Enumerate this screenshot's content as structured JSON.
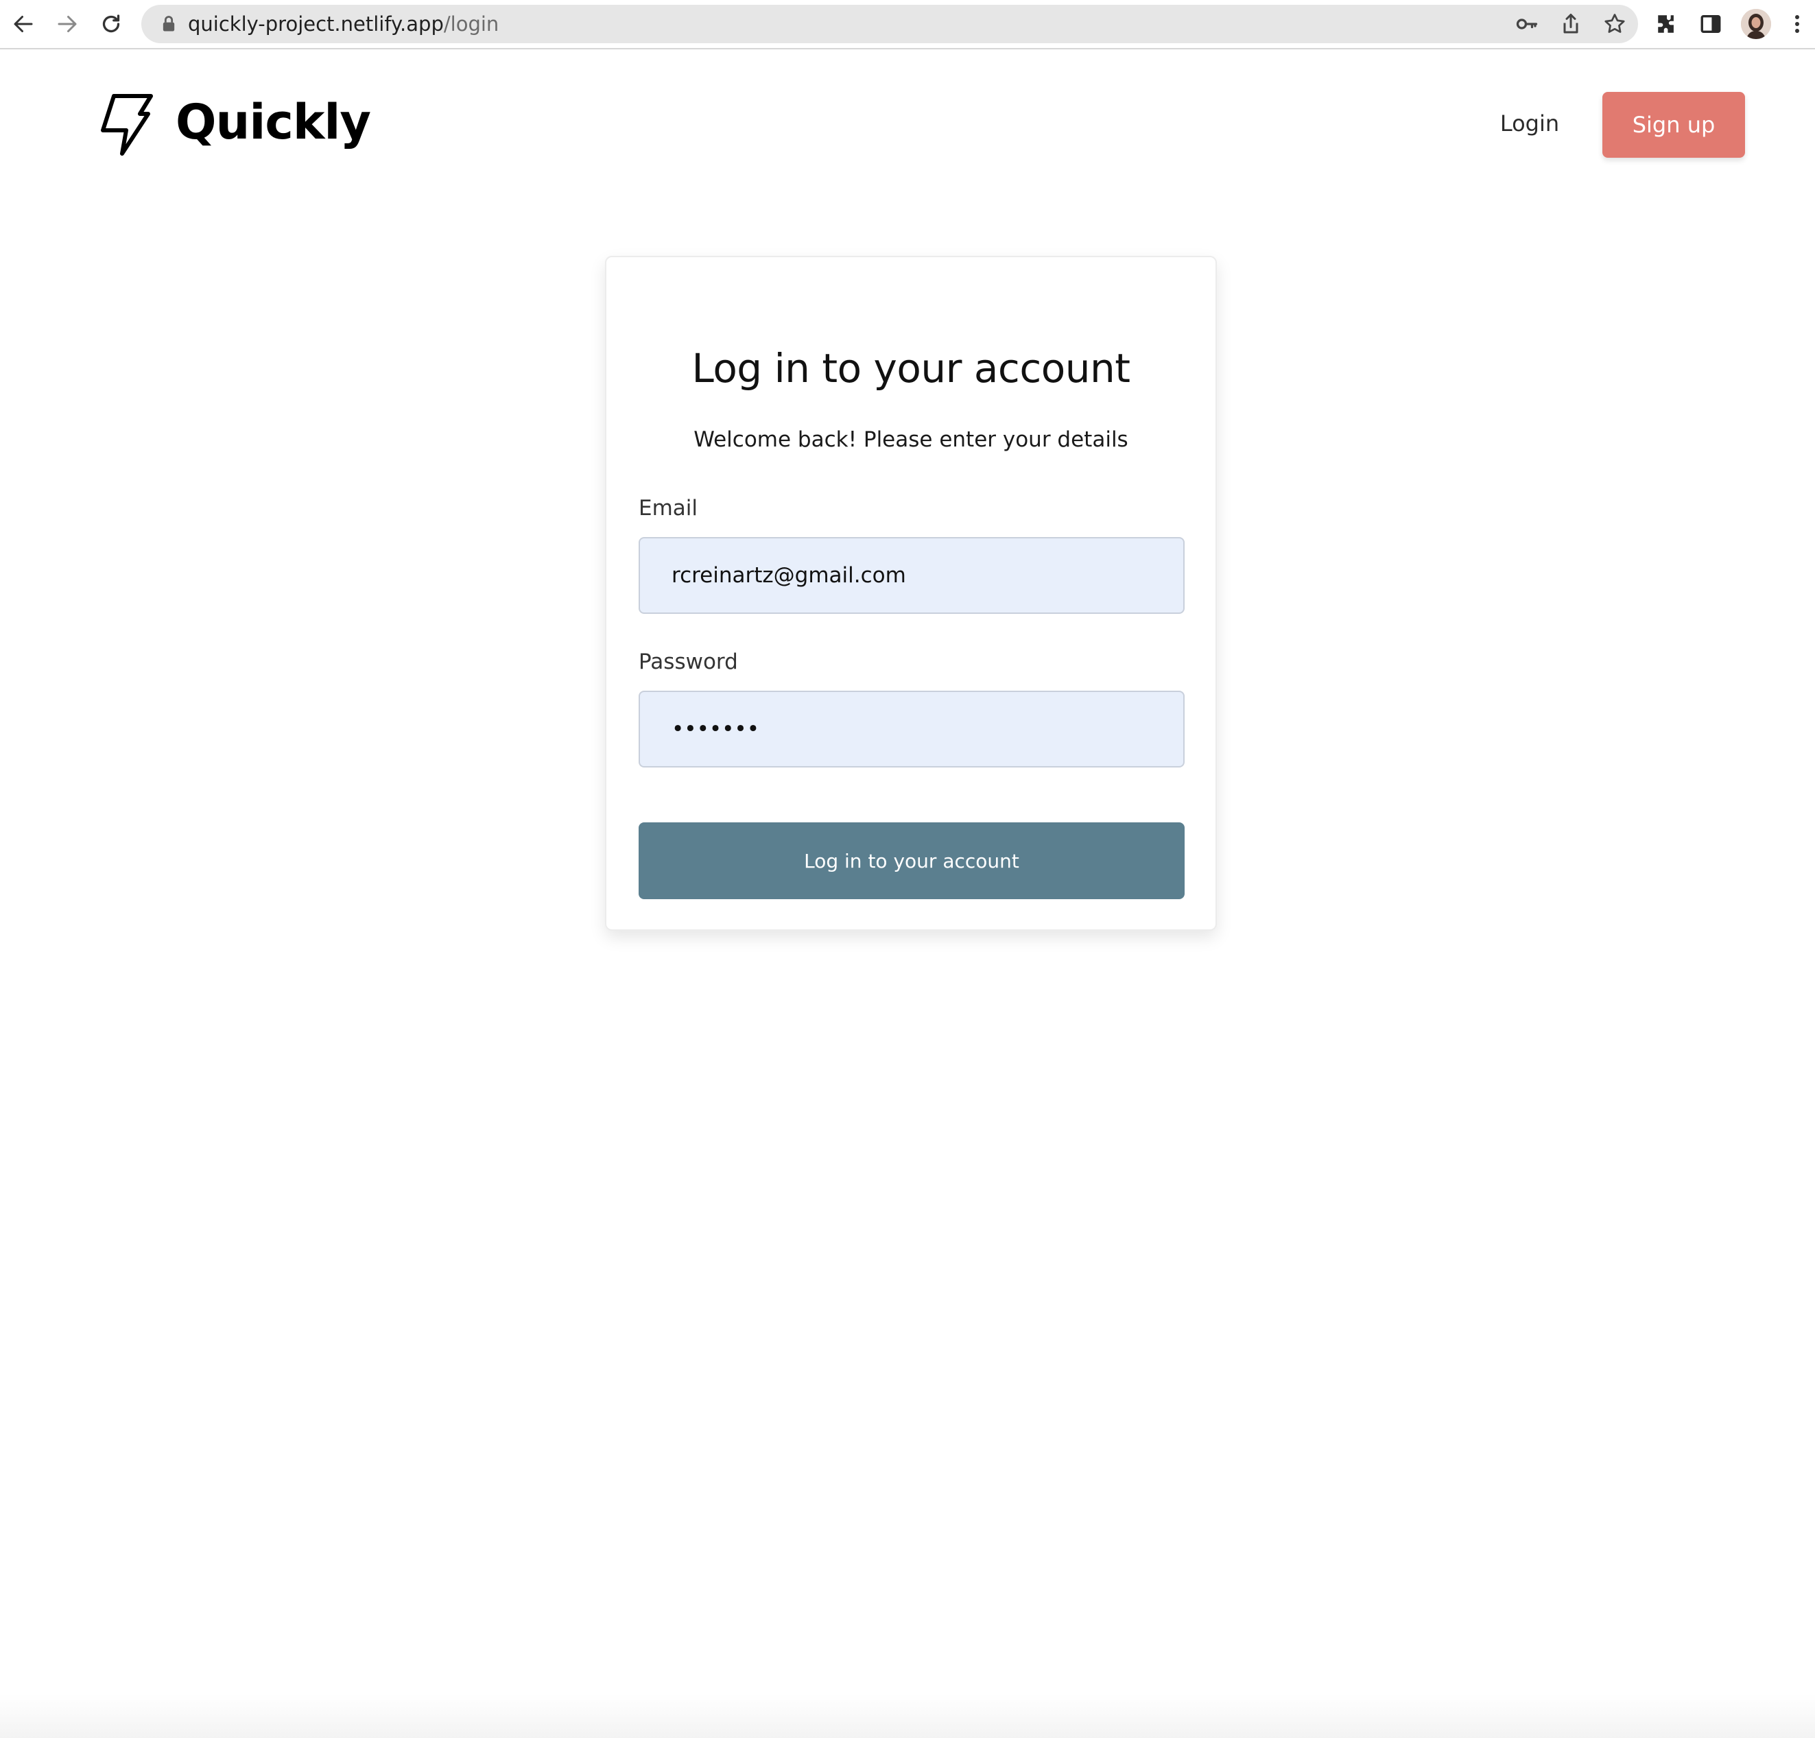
{
  "browser": {
    "url_host": "quickly-project.netlify.app",
    "url_path": "/login",
    "icons": [
      "back-arrow-icon",
      "forward-arrow-icon",
      "reload-icon",
      "lock-icon",
      "key-icon",
      "share-icon",
      "star-icon",
      "extensions-icon",
      "side-panel-icon",
      "profile-avatar",
      "more-vert-icon"
    ]
  },
  "header": {
    "brand": "Quickly",
    "login_link": "Login",
    "signup_button": "Sign up",
    "signup_color": "#e17a70"
  },
  "card": {
    "title": "Log in to your account",
    "subtitle": "Welcome back! Please enter your details",
    "email_label": "Email",
    "email_value": "rcreinartz@gmail.com",
    "password_label": "Password",
    "password_value": "•••••••",
    "submit_label": "Log in to your account",
    "submit_color": "#5b7f8f",
    "input_bg": "#e8effb"
  }
}
